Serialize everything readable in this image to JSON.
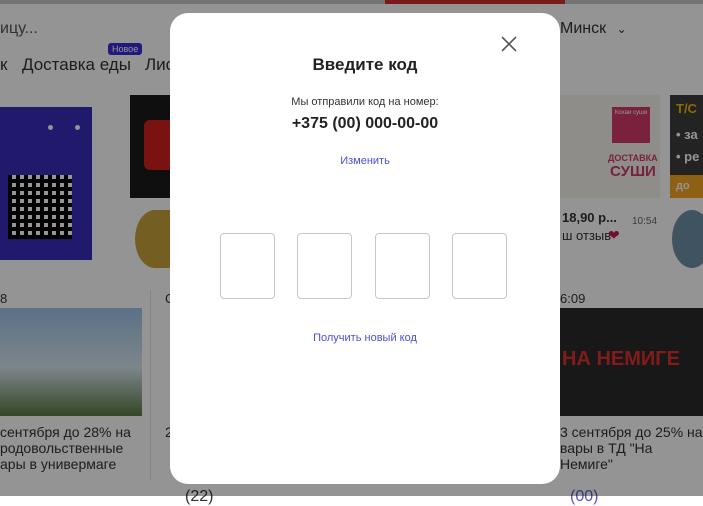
{
  "background": {
    "search_placeholder_tail": "ицу...",
    "city": "Минск",
    "nav": {
      "item_k": "к",
      "delivery": "Доставка еды",
      "badge": "Новое",
      "item_lis": "Лис"
    },
    "cards": {
      "price": "18,90 р...",
      "reviews": "ш отзыв",
      "time1": "10:54",
      "num_left": "8",
      "letter_mid": "С",
      "time2": "6:09",
      "left_text": [
        "сентября до 28% на",
        "родовольственные",
        "ары в универмаге"
      ],
      "mid_text_digit": "2",
      "right_text": [
        "3 сентября до 25% на",
        "вары в ТД \"На Немиге\""
      ],
      "sushi_top": "Кохаи суши",
      "sushi_a": "ДОСТАВКА",
      "sushi_b": "СУШИ",
      "promo_right": [
        "Т/С",
        "• за",
        "• ре",
        "до"
      ],
      "nemiga": "НА НЕМИГЕ"
    },
    "bottom_fragments": [
      "(22)",
      "(00)"
    ]
  },
  "modal": {
    "title": "Введите код",
    "sent_text": "Мы отправили код на номер:",
    "phone": "+375 (00) 000-00-00",
    "change_link": "Изменить",
    "resend_link": "Получить новый код",
    "code_digits": [
      "",
      "",
      "",
      ""
    ]
  },
  "colors": {
    "link": "#4a4fd8",
    "overlay": "rgba(0,0,0,0.42)",
    "accent_purple": "#3c2bd6"
  }
}
